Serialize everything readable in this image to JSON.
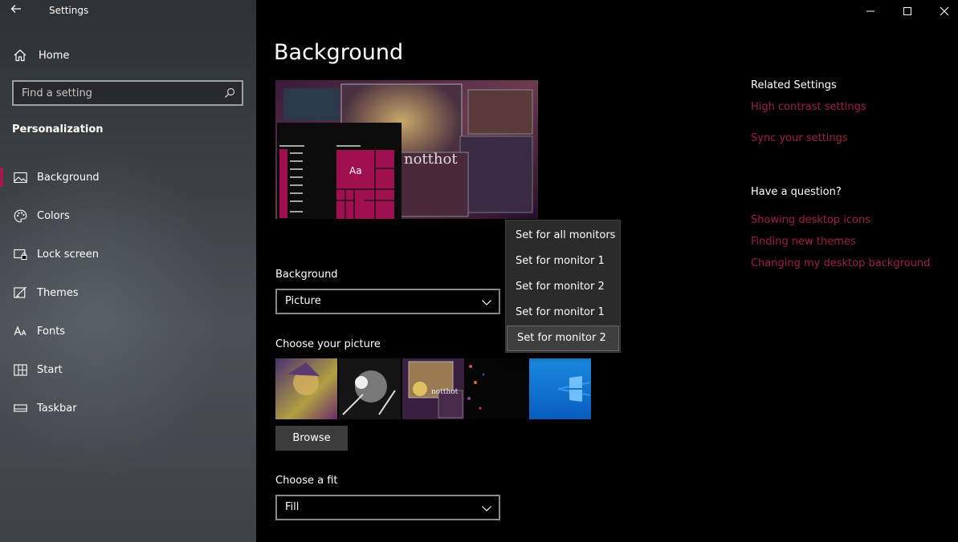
{
  "window": {
    "title": "Settings",
    "controls": {
      "minimize": "minimize-icon",
      "maximize": "maximize-icon",
      "close": "close-icon"
    }
  },
  "sidebar": {
    "home_label": "Home",
    "search_placeholder": "Find a setting",
    "section_title": "Personalization",
    "items": [
      {
        "label": "Background",
        "icon": "picture-icon",
        "active": true
      },
      {
        "label": "Colors",
        "icon": "palette-icon"
      },
      {
        "label": "Lock screen",
        "icon": "lock-screen-icon"
      },
      {
        "label": "Themes",
        "icon": "themes-icon"
      },
      {
        "label": "Fonts",
        "icon": "fonts-icon"
      },
      {
        "label": "Start",
        "icon": "start-icon"
      },
      {
        "label": "Taskbar",
        "icon": "taskbar-icon"
      }
    ]
  },
  "main": {
    "title": "Background",
    "preview": {
      "tile_text": "Aa",
      "wallpaper_text": "notthot"
    },
    "background_label": "Background",
    "background_value": "Picture",
    "choose_picture_label": "Choose your picture",
    "browse_label": "Browse",
    "choose_fit_label": "Choose a fit",
    "fit_value": "Fill",
    "thumb_texts": {
      "third": "notthot"
    }
  },
  "context_menu": {
    "items": [
      "Set for all monitors",
      "Set for monitor 1",
      "Set for monitor 2",
      "Set for monitor 1",
      "Set for monitor 2"
    ],
    "hovered_index": 4
  },
  "rail": {
    "related_title": "Related Settings",
    "related_links": [
      "High contrast settings",
      "Sync your settings"
    ],
    "question_title": "Have a question?",
    "question_links": [
      "Showing desktop icons",
      "Finding new themes",
      "Changing my desktop background"
    ]
  },
  "colors": {
    "accent": "#a5194f",
    "link": "#9c1f48",
    "tile": "#a0104f"
  }
}
